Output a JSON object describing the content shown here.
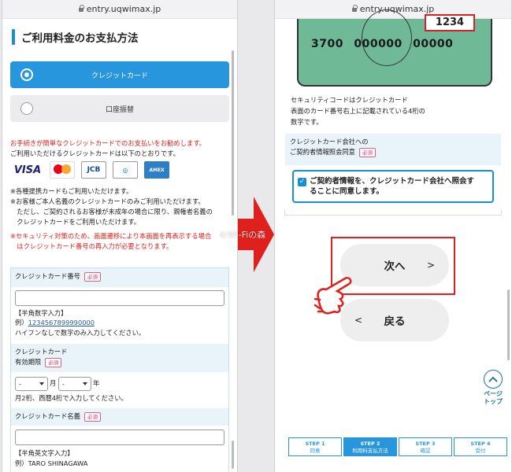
{
  "left": {
    "url": "entry.uqwimax.jp",
    "section_title": "ご利用料金のお支払方法",
    "payment_options": [
      "クレジットカード",
      "口座振替"
    ],
    "recommend_text": "お手続きが簡単なクレジットカードでのお支払いをお勧めします。",
    "available_text": "ご利用いただけるクレジットカードは以下のとおりです。",
    "card_brands": [
      "VISA",
      "mastercard",
      "JCB",
      "Diners Club International",
      "AMEX"
    ],
    "notes": [
      "※各種提携カードもご利用いただけます。",
      "※お客様ご本人名義のクレジットカードのみご利用いただけます。",
      "　ただし、ご契約されるお客様が未成年の場合に限り、親権者名義の",
      "　クレジットカードをご利用いただけます。"
    ],
    "security_notes": [
      "※セキュリティ対策のため、画面遷移により本画面を再表示する場合",
      "　はクレジットカード番号の再入力が必要となります。"
    ],
    "form": {
      "card_number_label": "クレジットカード番号",
      "required": "必須",
      "card_number_format": "【半角数字入力】",
      "card_number_example_prefix": "例）",
      "card_number_example": "1234567899990000",
      "card_number_hint": "ハイフンなしで数字のみ入力してください。",
      "expiry_label_1": "クレジットカード",
      "expiry_label_2": "有効期限",
      "month_value": "-",
      "month_unit": "月",
      "year_value": "-",
      "year_unit": "年",
      "expiry_hint": "月2桁、西暦4桁で入力してください。",
      "name_label": "クレジットカード名義",
      "name_format": "【半角英文字入力】",
      "name_example": "例）TARO SHINAGAWA"
    }
  },
  "right": {
    "url": "entry.uqwimax.jp",
    "card_code": "1234",
    "card_number": "3700 000000 00000",
    "security_text": [
      "セキュリティコードはクレジットカード",
      "表面のカード番号右上に記載されている4桁の",
      "数字です。"
    ],
    "agree_head_1": "クレジットカード会社への",
    "agree_head_2": "ご契約者情報照会同意",
    "agree_text_1": "ご契約者情報を、クレジットカード会社へ照会す",
    "agree_text_2": "ることに同意します。",
    "next_label": "次へ",
    "next_chevron": ">",
    "back_label": "戻る",
    "back_chevron": "<",
    "watermark": "©Wi-Fiの森",
    "page_top_1": "ページ",
    "page_top_2": "トップ",
    "steps": [
      {
        "num": "STEP 1",
        "label": "同意"
      },
      {
        "num": "STEP 2",
        "label": "利用料支払方法"
      },
      {
        "num": "STEP 3",
        "label": "確認"
      },
      {
        "num": "STEP 4",
        "label": "受付"
      }
    ]
  },
  "colors": {
    "accent": "#2896dc",
    "alert": "#e0201c",
    "card": "#6fb997"
  }
}
